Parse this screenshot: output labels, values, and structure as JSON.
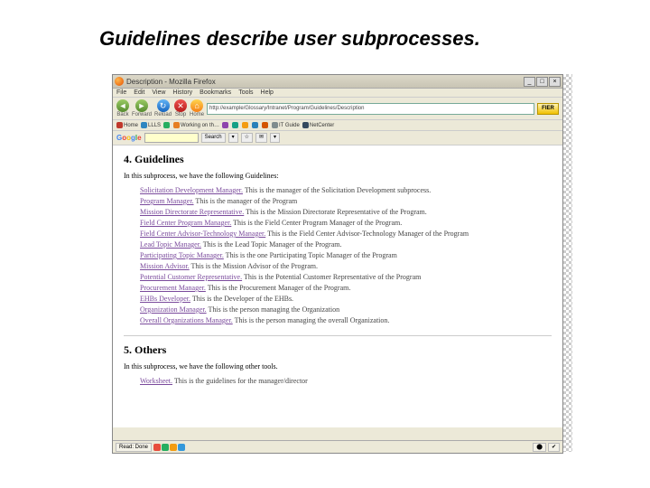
{
  "slide": {
    "title": "Guidelines describe user subprocesses."
  },
  "window": {
    "title": "Description - Mozilla Firefox",
    "min": "_",
    "max": "□",
    "close": "×"
  },
  "menus": [
    "File",
    "Edit",
    "View",
    "History",
    "Bookmarks",
    "Tools",
    "Help"
  ],
  "nav": {
    "back": "Back",
    "forward": "Forward",
    "reload": "Reload",
    "stop": "Stop",
    "home": "Home",
    "url": "http://example/Glossary/Intranet/Program/Guidelines/Description",
    "go": "FIER"
  },
  "bookmarks": [
    {
      "label": "Home",
      "color": "#c0392b"
    },
    {
      "label": "LLLS",
      "color": "#2e86c1"
    },
    {
      "label": "",
      "color": "#27ae60"
    },
    {
      "label": "Working on th…",
      "color": "#e67e22"
    },
    {
      "label": "",
      "color": "#8e44ad"
    },
    {
      "label": "",
      "color": "#16a085"
    },
    {
      "label": "",
      "color": "#f39c12"
    },
    {
      "label": "",
      "color": "#2980b9"
    },
    {
      "label": "",
      "color": "#d35400"
    },
    {
      "label": "IT Guide",
      "color": "#7f8c8d"
    },
    {
      "label": "NetCenter",
      "color": "#34495e"
    }
  ],
  "google": {
    "search_label": "Search",
    "placeholder": ""
  },
  "doc": {
    "section1_num": "4. Guidelines",
    "section1_intro": "In this subprocess, we have the following Guidelines:",
    "guidelines": [
      {
        "link": "Solicitation Development Manager.",
        "desc": " This is the manager of the Solicitation Development subprocess."
      },
      {
        "link": "Program Manager.",
        "desc": " This is the manager of the Program"
      },
      {
        "link": "Mission Directorate Representative.",
        "desc": " This is the Mission Directorate Representative of the Program."
      },
      {
        "link": "Field Center Program Manager.",
        "desc": " This is the Field Center Program Manager of the Program."
      },
      {
        "link": "Field Center Advisor-Technology Manager.",
        "desc": " This is the Field Center Advisor-Technology Manager of the Program"
      },
      {
        "link": "Lead Topic Manager.",
        "desc": " This is the Lead Topic Manager of the Program."
      },
      {
        "link": "Participating Topic Manager.",
        "desc": " This is the one Participating Topic Manager of the Program"
      },
      {
        "link": "Mission Advisor.",
        "desc": " This is the Mission Advisor of the Program."
      },
      {
        "link": "Potential Customer Representative.",
        "desc": " This is the Potential Customer Representative of the Program"
      },
      {
        "link": "Procurement Manager.",
        "desc": " This is the Procurement Manager of the Program."
      },
      {
        "link": "EHBs Developer.",
        "desc": " This is the Developer of the EHBs."
      },
      {
        "link": "Organization Manager.",
        "desc": " This is the person managing the Organization"
      },
      {
        "link": "Overall Organizations Manager.",
        "desc": " This is the person managing the overall Organization."
      }
    ],
    "section2_num": "5. Others",
    "section2_intro": "In this subprocess, we have the following other tools.",
    "others": [
      {
        "link": "Worksheet.",
        "desc": " This is the guidelines for the manager/director"
      }
    ]
  },
  "status": {
    "left": "Read: Done"
  }
}
